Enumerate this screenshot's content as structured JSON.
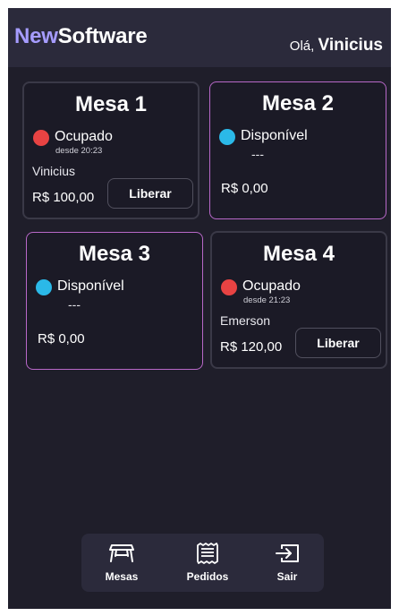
{
  "header": {
    "logo_new": "New",
    "logo_software": "Software",
    "greeting": "Olá,",
    "user_name": "Vinicius"
  },
  "tables": [
    {
      "title": "Mesa 1",
      "status": "Ocupado",
      "status_color": "#e84343",
      "since": "desde 20:23",
      "client": "Vinicius",
      "total": "R$ 100,00",
      "action": "Liberar"
    },
    {
      "title": "Mesa 2",
      "status": "Disponível",
      "status_color": "#2bb9e8",
      "placeholder": "---",
      "total": "R$ 0,00"
    },
    {
      "title": "Mesa 3",
      "status": "Disponível",
      "status_color": "#2bb9e8",
      "placeholder": "---",
      "total": "R$ 0,00"
    },
    {
      "title": "Mesa 4",
      "status": "Ocupado",
      "status_color": "#e84343",
      "since": "desde 21:23",
      "client": "Emerson",
      "total": "R$ 120,00",
      "action": "Liberar"
    }
  ],
  "nav": {
    "items": [
      {
        "label": "Mesas",
        "icon": "table-icon"
      },
      {
        "label": "Pedidos",
        "icon": "receipt-icon"
      },
      {
        "label": "Sair",
        "icon": "logout-icon"
      }
    ]
  },
  "colors": {
    "brand_accent": "#a69cff",
    "background": "#1f1e2a",
    "header": "#2b2a3b",
    "free_border": "#b868c8"
  }
}
